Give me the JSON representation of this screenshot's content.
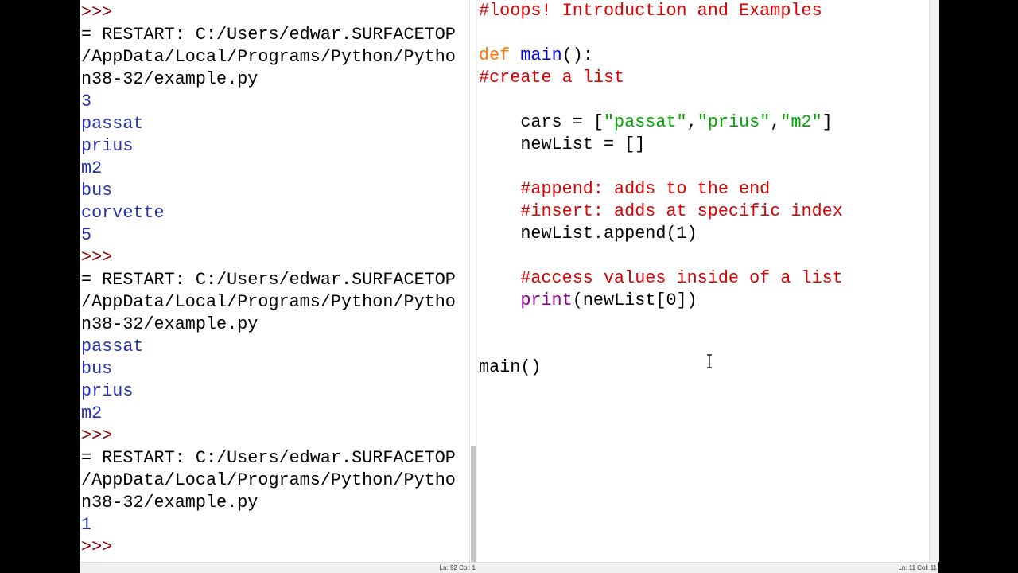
{
  "shell": {
    "lines": [
      {
        "kind": "prompt",
        "text": ">>>"
      },
      {
        "kind": "restart",
        "text": "= RESTART: C:/Users/edwar.SURFACETOP"
      },
      {
        "kind": "restart",
        "text": "/AppData/Local/Programs/Python/Pytho"
      },
      {
        "kind": "restart",
        "text": "n38-32/example.py"
      },
      {
        "kind": "stdout",
        "text": "3"
      },
      {
        "kind": "stdout",
        "text": "passat"
      },
      {
        "kind": "stdout",
        "text": "prius"
      },
      {
        "kind": "stdout",
        "text": "m2"
      },
      {
        "kind": "stdout",
        "text": "bus"
      },
      {
        "kind": "stdout",
        "text": "corvette"
      },
      {
        "kind": "stdout",
        "text": "5"
      },
      {
        "kind": "prompt",
        "text": ">>>"
      },
      {
        "kind": "restart",
        "text": "= RESTART: C:/Users/edwar.SURFACETOP"
      },
      {
        "kind": "restart",
        "text": "/AppData/Local/Programs/Python/Pytho"
      },
      {
        "kind": "restart",
        "text": "n38-32/example.py"
      },
      {
        "kind": "stdout",
        "text": "passat"
      },
      {
        "kind": "stdout",
        "text": "bus"
      },
      {
        "kind": "stdout",
        "text": "prius"
      },
      {
        "kind": "stdout",
        "text": "m2"
      },
      {
        "kind": "prompt",
        "text": ">>>"
      },
      {
        "kind": "restart",
        "text": "= RESTART: C:/Users/edwar.SURFACETOP"
      },
      {
        "kind": "restart",
        "text": "/AppData/Local/Programs/Python/Pytho"
      },
      {
        "kind": "restart",
        "text": "n38-32/example.py"
      },
      {
        "kind": "stdout",
        "text": "1"
      },
      {
        "kind": "prompt",
        "text": ">>> "
      }
    ],
    "status": "Ln: 92  Col: 1"
  },
  "editor": {
    "lines": [
      [
        {
          "c": "cm",
          "t": "#loops! Introduction and Examples"
        }
      ],
      [],
      [
        {
          "c": "kw",
          "t": "def "
        },
        {
          "c": "def",
          "t": "main"
        },
        {
          "c": "plain",
          "t": "():"
        }
      ],
      [
        {
          "c": "cm",
          "t": "#create a list"
        }
      ],
      [],
      [
        {
          "c": "plain",
          "t": "    cars = ["
        },
        {
          "c": "str",
          "t": "\"passat\""
        },
        {
          "c": "plain",
          "t": ","
        },
        {
          "c": "str",
          "t": "\"prius\""
        },
        {
          "c": "plain",
          "t": ","
        },
        {
          "c": "str",
          "t": "\"m2\""
        },
        {
          "c": "plain",
          "t": "]"
        }
      ],
      [
        {
          "c": "plain",
          "t": "    newList = []"
        }
      ],
      [],
      [
        {
          "c": "cm",
          "t": "    #append: adds to the end"
        }
      ],
      [
        {
          "c": "cm",
          "t": "    #insert: adds at specific index"
        }
      ],
      [
        {
          "c": "plain",
          "t": "    newList.append(1)"
        }
      ],
      [],
      [
        {
          "c": "cm",
          "t": "    #access values inside of a list"
        }
      ],
      [
        {
          "c": "bi",
          "t": "    print"
        },
        {
          "c": "plain",
          "t": "(newList[0])"
        }
      ],
      [],
      [],
      [
        {
          "c": "plain",
          "t": "main()"
        }
      ]
    ],
    "status": "Ln: 11  Col: 11"
  },
  "colors": {
    "prompt": "#8b0000",
    "stdout": "#2430b0",
    "keyword": "#ff7700",
    "definition": "#0000ff",
    "builtin": "#900090",
    "string": "#00aa00",
    "comment": "#dd0000"
  }
}
